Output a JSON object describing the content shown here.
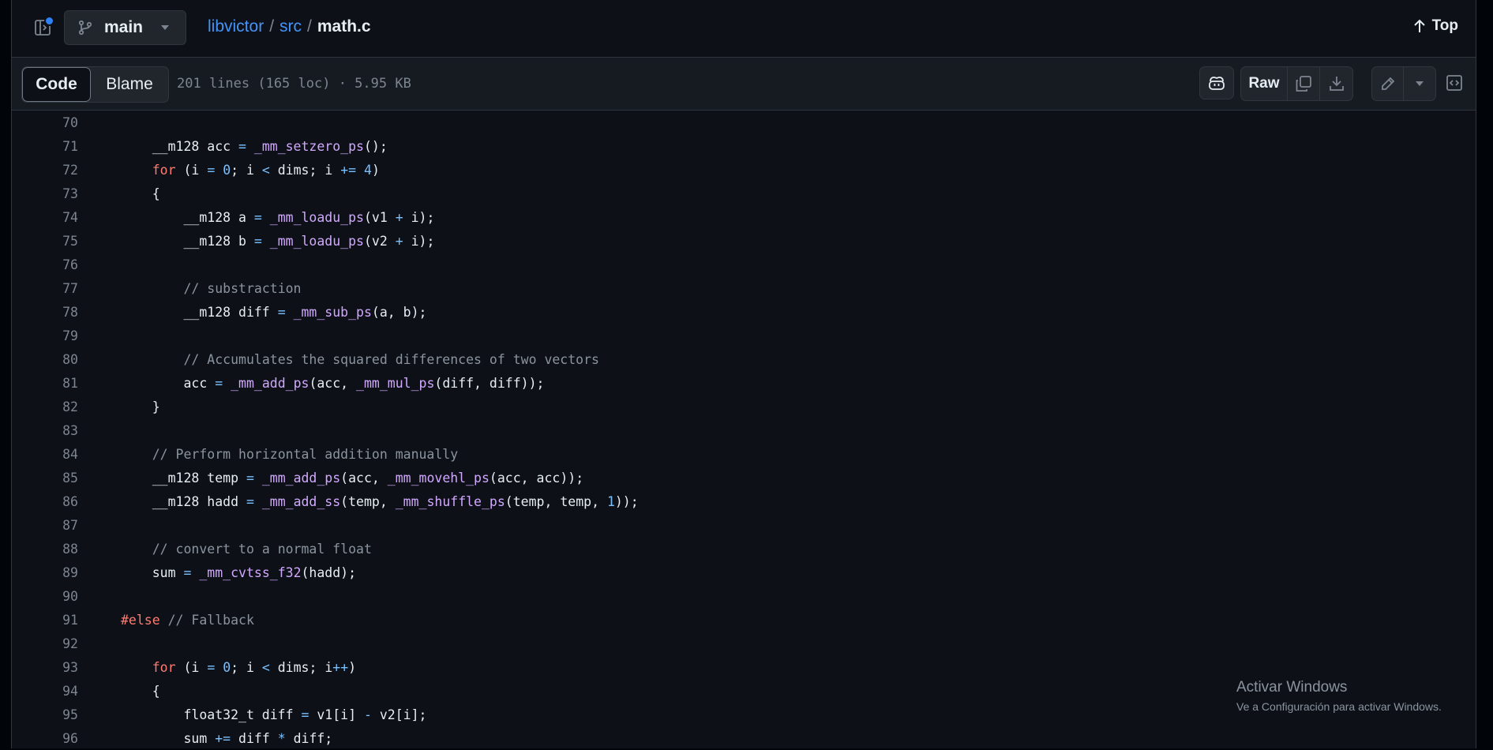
{
  "header": {
    "branch": "main",
    "breadcrumb": {
      "repo": "libvictor",
      "dir": "src",
      "sep": "/",
      "file": "math.c"
    },
    "top_label": "Top"
  },
  "toolbar": {
    "code_tab": "Code",
    "blame_tab": "Blame",
    "file_meta": "201 lines (165 loc) · 5.95 KB",
    "raw_label": "Raw",
    "icons": [
      "copilot-icon",
      "copy-icon",
      "download-icon",
      "pencil-icon",
      "triangle-down-icon",
      "symbols-icon"
    ]
  },
  "code": {
    "lines": [
      {
        "n": "70",
        "tokens": []
      },
      {
        "n": "71",
        "tokens": [
          [
            "",
            "    __m128 acc "
          ],
          [
            "op",
            "="
          ],
          [
            "",
            " "
          ],
          [
            "fn",
            "_mm_setzero_ps"
          ],
          [
            "",
            "();"
          ]
        ]
      },
      {
        "n": "72",
        "tokens": [
          [
            "",
            "    "
          ],
          [
            "kw",
            "for"
          ],
          [
            "",
            " (i "
          ],
          [
            "op",
            "="
          ],
          [
            "",
            " "
          ],
          [
            "num",
            "0"
          ],
          [
            "",
            "; i "
          ],
          [
            "op",
            "<"
          ],
          [
            "",
            " dims; i "
          ],
          [
            "op",
            "+="
          ],
          [
            "",
            " "
          ],
          [
            "num",
            "4"
          ],
          [
            "",
            ")"
          ]
        ]
      },
      {
        "n": "73",
        "tokens": [
          [
            "",
            "    {"
          ]
        ]
      },
      {
        "n": "74",
        "tokens": [
          [
            "",
            "        __m128 a "
          ],
          [
            "op",
            "="
          ],
          [
            "",
            " "
          ],
          [
            "fn",
            "_mm_loadu_ps"
          ],
          [
            "",
            "(v1 "
          ],
          [
            "op",
            "+"
          ],
          [
            "",
            " i);"
          ]
        ]
      },
      {
        "n": "75",
        "tokens": [
          [
            "",
            "        __m128 b "
          ],
          [
            "op",
            "="
          ],
          [
            "",
            " "
          ],
          [
            "fn",
            "_mm_loadu_ps"
          ],
          [
            "",
            "(v2 "
          ],
          [
            "op",
            "+"
          ],
          [
            "",
            " i);"
          ]
        ]
      },
      {
        "n": "76",
        "tokens": []
      },
      {
        "n": "77",
        "tokens": [
          [
            "",
            "        "
          ],
          [
            "cm",
            "// substraction"
          ]
        ]
      },
      {
        "n": "78",
        "tokens": [
          [
            "",
            "        __m128 diff "
          ],
          [
            "op",
            "="
          ],
          [
            "",
            " "
          ],
          [
            "fn",
            "_mm_sub_ps"
          ],
          [
            "",
            "(a, b);"
          ]
        ]
      },
      {
        "n": "79",
        "tokens": []
      },
      {
        "n": "80",
        "tokens": [
          [
            "",
            "        "
          ],
          [
            "cm",
            "// Accumulates the squared differences of two vectors"
          ]
        ]
      },
      {
        "n": "81",
        "tokens": [
          [
            "",
            "        acc "
          ],
          [
            "op",
            "="
          ],
          [
            "",
            " "
          ],
          [
            "fn",
            "_mm_add_ps"
          ],
          [
            "",
            "(acc, "
          ],
          [
            "fn",
            "_mm_mul_ps"
          ],
          [
            "",
            "(diff, diff));"
          ]
        ]
      },
      {
        "n": "82",
        "tokens": [
          [
            "",
            "    }"
          ]
        ]
      },
      {
        "n": "83",
        "tokens": []
      },
      {
        "n": "84",
        "tokens": [
          [
            "",
            "    "
          ],
          [
            "cm",
            "// Perform horizontal addition manually"
          ]
        ]
      },
      {
        "n": "85",
        "tokens": [
          [
            "",
            "    __m128 temp "
          ],
          [
            "op",
            "="
          ],
          [
            "",
            " "
          ],
          [
            "fn",
            "_mm_add_ps"
          ],
          [
            "",
            "(acc, "
          ],
          [
            "fn",
            "_mm_movehl_ps"
          ],
          [
            "",
            "(acc, acc));"
          ]
        ]
      },
      {
        "n": "86",
        "tokens": [
          [
            "",
            "    __m128 hadd "
          ],
          [
            "op",
            "="
          ],
          [
            "",
            " "
          ],
          [
            "fn",
            "_mm_add_ss"
          ],
          [
            "",
            "(temp, "
          ],
          [
            "fn",
            "_mm_shuffle_ps"
          ],
          [
            "",
            "(temp, temp, "
          ],
          [
            "num",
            "1"
          ],
          [
            "",
            "));"
          ]
        ]
      },
      {
        "n": "87",
        "tokens": []
      },
      {
        "n": "88",
        "tokens": [
          [
            "",
            "    "
          ],
          [
            "cm",
            "// convert to a normal float"
          ]
        ]
      },
      {
        "n": "89",
        "tokens": [
          [
            "",
            "    sum "
          ],
          [
            "op",
            "="
          ],
          [
            "",
            " "
          ],
          [
            "fn",
            "_mm_cvtss_f32"
          ],
          [
            "",
            "(hadd);"
          ]
        ]
      },
      {
        "n": "90",
        "tokens": []
      },
      {
        "n": "91",
        "tokens": [
          [
            "kw",
            "#else"
          ],
          [
            "",
            " "
          ],
          [
            "cm",
            "// Fallback"
          ]
        ]
      },
      {
        "n": "92",
        "tokens": []
      },
      {
        "n": "93",
        "tokens": [
          [
            "",
            "    "
          ],
          [
            "kw",
            "for"
          ],
          [
            "",
            " (i "
          ],
          [
            "op",
            "="
          ],
          [
            "",
            " "
          ],
          [
            "num",
            "0"
          ],
          [
            "",
            "; i "
          ],
          [
            "op",
            "<"
          ],
          [
            "",
            " dims; i"
          ],
          [
            "op",
            "++"
          ],
          [
            "",
            ")"
          ]
        ]
      },
      {
        "n": "94",
        "tokens": [
          [
            "",
            "    {"
          ]
        ]
      },
      {
        "n": "95",
        "tokens": [
          [
            "",
            "        float32_t diff "
          ],
          [
            "op",
            "="
          ],
          [
            "",
            " v1[i] "
          ],
          [
            "op",
            "-"
          ],
          [
            "",
            " v2[i];"
          ]
        ]
      },
      {
        "n": "96",
        "tokens": [
          [
            "",
            "        sum "
          ],
          [
            "op",
            "+="
          ],
          [
            "",
            " diff "
          ],
          [
            "op",
            "*"
          ],
          [
            "",
            " diff;"
          ]
        ]
      }
    ]
  },
  "watermark": {
    "title": "Activar Windows",
    "subtitle": "Ve a Configuración para activar Windows."
  },
  "colors": {
    "accent": "#4493f8",
    "keyword": "#ff7b72",
    "function": "#d2a8ff",
    "operator": "#79c0ff",
    "comment": "#8b949e"
  }
}
